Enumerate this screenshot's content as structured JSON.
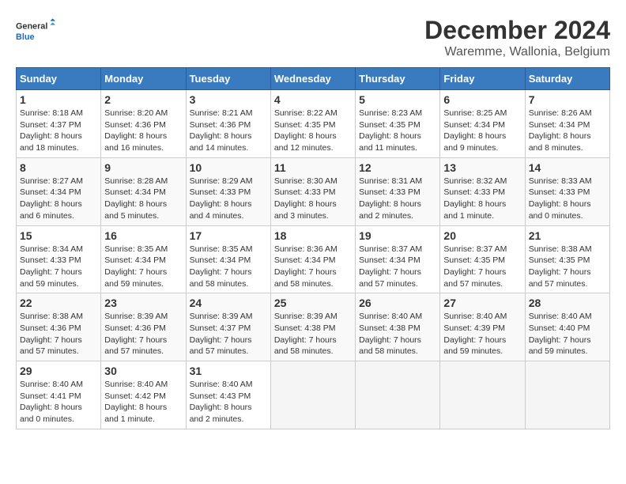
{
  "logo": {
    "general": "General",
    "blue": "Blue"
  },
  "title": "December 2024",
  "location": "Waremme, Wallonia, Belgium",
  "days_of_week": [
    "Sunday",
    "Monday",
    "Tuesday",
    "Wednesday",
    "Thursday",
    "Friday",
    "Saturday"
  ],
  "weeks": [
    [
      {
        "day": "1",
        "sunrise": "8:18 AM",
        "sunset": "4:37 PM",
        "daylight": "8 hours and 18 minutes."
      },
      {
        "day": "2",
        "sunrise": "8:20 AM",
        "sunset": "4:36 PM",
        "daylight": "8 hours and 16 minutes."
      },
      {
        "day": "3",
        "sunrise": "8:21 AM",
        "sunset": "4:36 PM",
        "daylight": "8 hours and 14 minutes."
      },
      {
        "day": "4",
        "sunrise": "8:22 AM",
        "sunset": "4:35 PM",
        "daylight": "8 hours and 12 minutes."
      },
      {
        "day": "5",
        "sunrise": "8:23 AM",
        "sunset": "4:35 PM",
        "daylight": "8 hours and 11 minutes."
      },
      {
        "day": "6",
        "sunrise": "8:25 AM",
        "sunset": "4:34 PM",
        "daylight": "8 hours and 9 minutes."
      },
      {
        "day": "7",
        "sunrise": "8:26 AM",
        "sunset": "4:34 PM",
        "daylight": "8 hours and 8 minutes."
      }
    ],
    [
      {
        "day": "8",
        "sunrise": "8:27 AM",
        "sunset": "4:34 PM",
        "daylight": "8 hours and 6 minutes."
      },
      {
        "day": "9",
        "sunrise": "8:28 AM",
        "sunset": "4:34 PM",
        "daylight": "8 hours and 5 minutes."
      },
      {
        "day": "10",
        "sunrise": "8:29 AM",
        "sunset": "4:33 PM",
        "daylight": "8 hours and 4 minutes."
      },
      {
        "day": "11",
        "sunrise": "8:30 AM",
        "sunset": "4:33 PM",
        "daylight": "8 hours and 3 minutes."
      },
      {
        "day": "12",
        "sunrise": "8:31 AM",
        "sunset": "4:33 PM",
        "daylight": "8 hours and 2 minutes."
      },
      {
        "day": "13",
        "sunrise": "8:32 AM",
        "sunset": "4:33 PM",
        "daylight": "8 hours and 1 minute."
      },
      {
        "day": "14",
        "sunrise": "8:33 AM",
        "sunset": "4:33 PM",
        "daylight": "8 hours and 0 minutes."
      }
    ],
    [
      {
        "day": "15",
        "sunrise": "8:34 AM",
        "sunset": "4:33 PM",
        "daylight": "7 hours and 59 minutes."
      },
      {
        "day": "16",
        "sunrise": "8:35 AM",
        "sunset": "4:34 PM",
        "daylight": "7 hours and 59 minutes."
      },
      {
        "day": "17",
        "sunrise": "8:35 AM",
        "sunset": "4:34 PM",
        "daylight": "7 hours and 58 minutes."
      },
      {
        "day": "18",
        "sunrise": "8:36 AM",
        "sunset": "4:34 PM",
        "daylight": "7 hours and 58 minutes."
      },
      {
        "day": "19",
        "sunrise": "8:37 AM",
        "sunset": "4:34 PM",
        "daylight": "7 hours and 57 minutes."
      },
      {
        "day": "20",
        "sunrise": "8:37 AM",
        "sunset": "4:35 PM",
        "daylight": "7 hours and 57 minutes."
      },
      {
        "day": "21",
        "sunrise": "8:38 AM",
        "sunset": "4:35 PM",
        "daylight": "7 hours and 57 minutes."
      }
    ],
    [
      {
        "day": "22",
        "sunrise": "8:38 AM",
        "sunset": "4:36 PM",
        "daylight": "7 hours and 57 minutes."
      },
      {
        "day": "23",
        "sunrise": "8:39 AM",
        "sunset": "4:36 PM",
        "daylight": "7 hours and 57 minutes."
      },
      {
        "day": "24",
        "sunrise": "8:39 AM",
        "sunset": "4:37 PM",
        "daylight": "7 hours and 57 minutes."
      },
      {
        "day": "25",
        "sunrise": "8:39 AM",
        "sunset": "4:38 PM",
        "daylight": "7 hours and 58 minutes."
      },
      {
        "day": "26",
        "sunrise": "8:40 AM",
        "sunset": "4:38 PM",
        "daylight": "7 hours and 58 minutes."
      },
      {
        "day": "27",
        "sunrise": "8:40 AM",
        "sunset": "4:39 PM",
        "daylight": "7 hours and 59 minutes."
      },
      {
        "day": "28",
        "sunrise": "8:40 AM",
        "sunset": "4:40 PM",
        "daylight": "7 hours and 59 minutes."
      }
    ],
    [
      {
        "day": "29",
        "sunrise": "8:40 AM",
        "sunset": "4:41 PM",
        "daylight": "8 hours and 0 minutes."
      },
      {
        "day": "30",
        "sunrise": "8:40 AM",
        "sunset": "4:42 PM",
        "daylight": "8 hours and 1 minute."
      },
      {
        "day": "31",
        "sunrise": "8:40 AM",
        "sunset": "4:43 PM",
        "daylight": "8 hours and 2 minutes."
      },
      null,
      null,
      null,
      null
    ]
  ],
  "labels": {
    "sunrise": "Sunrise:",
    "sunset": "Sunset:",
    "daylight": "Daylight:"
  }
}
